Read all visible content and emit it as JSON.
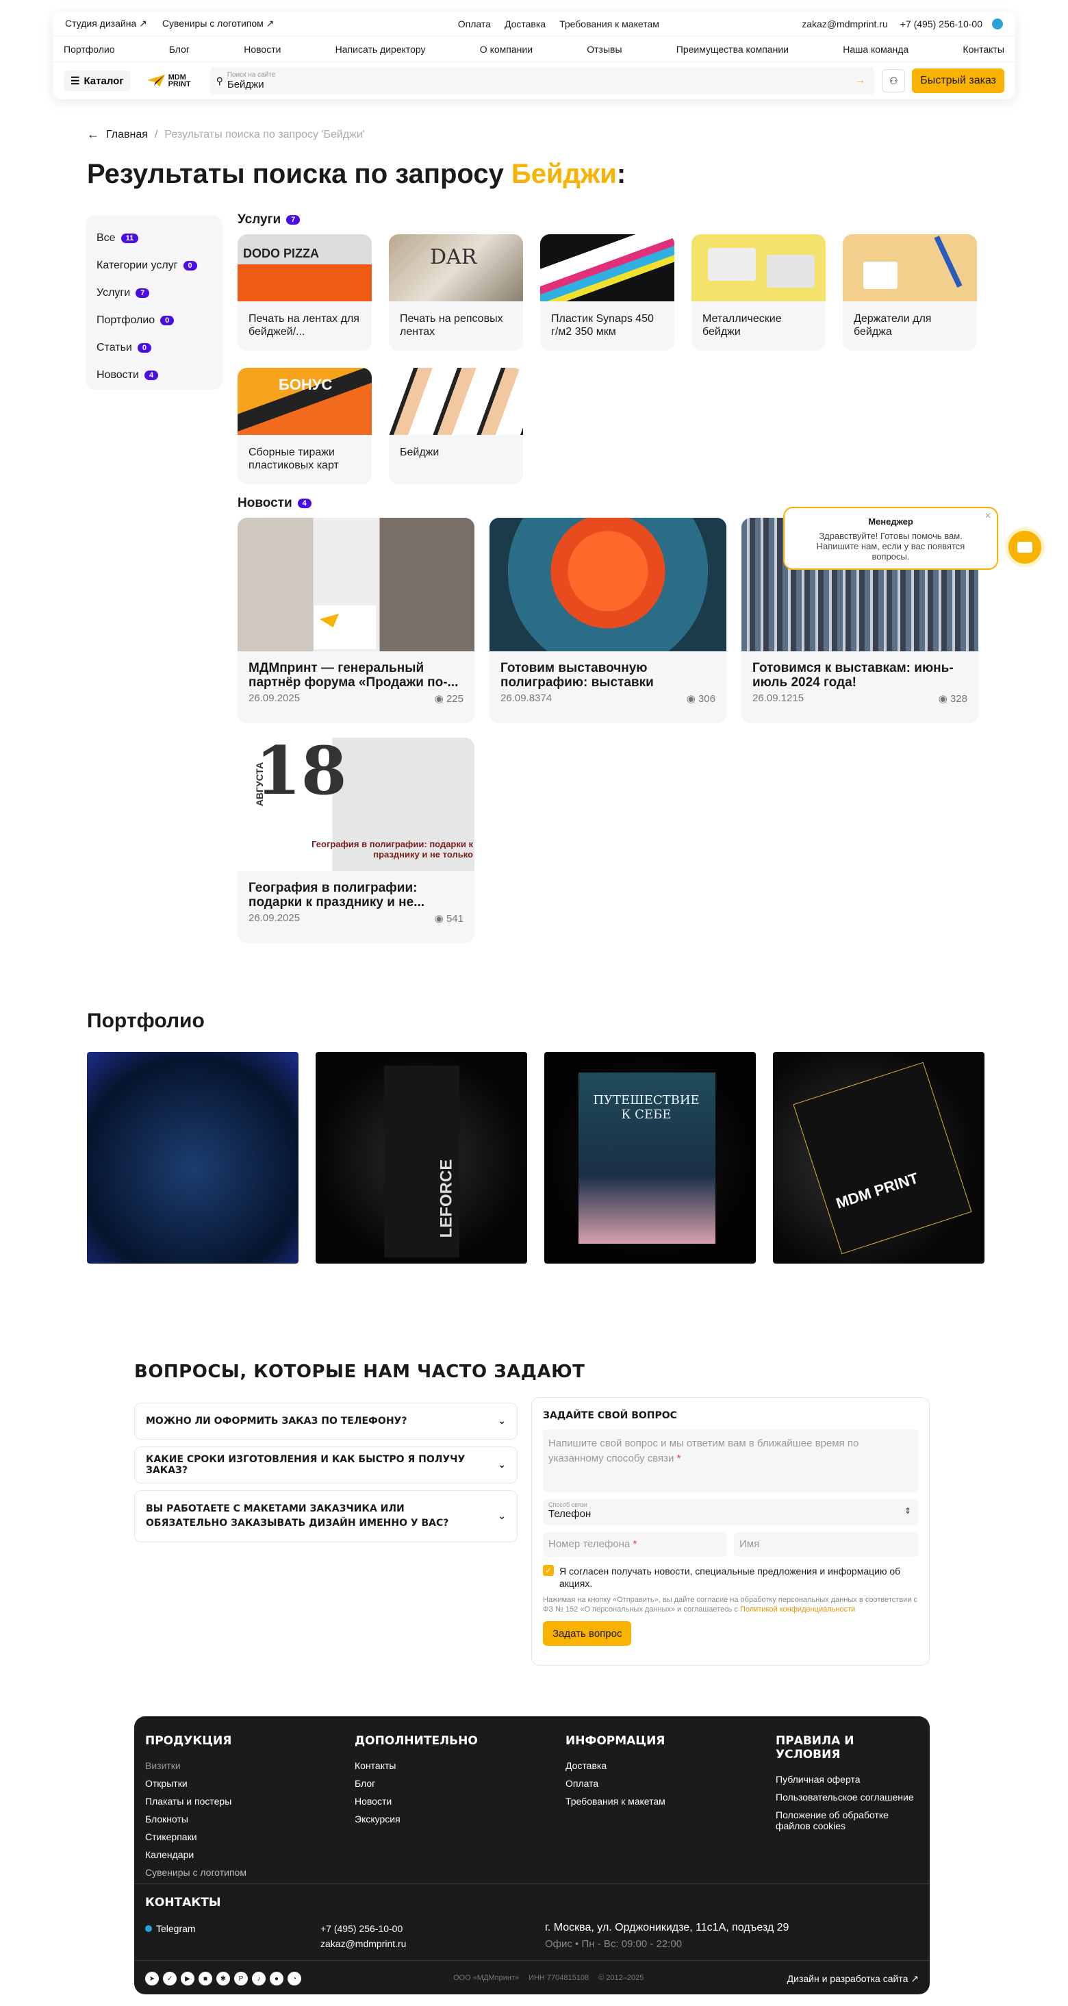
{
  "header": {
    "top_links": [
      "Студия дизайна ↗",
      "Сувениры с логотипом ↗"
    ],
    "top_center": [
      "Оплата",
      "Доставка",
      "Требования к макетам"
    ],
    "email": "zakaz@mdmprint.ru",
    "phone": "+7 (495) 256-10-00",
    "nav": [
      "Портфолио",
      "Блог",
      "Новости",
      "Написать директору",
      "О компании",
      "Отзывы",
      "Преимущества компании",
      "Наша команда",
      "Контакты"
    ],
    "catalog": "Каталог",
    "logo": "MDM PRINT",
    "search_placeholder": "Поиск на сайте",
    "search_value": "Бейджи",
    "quick_order": "Быстрый заказ"
  },
  "breadcrumb": {
    "home": "Главная",
    "sep": "/",
    "current": "Результаты поиска по запросу 'Бейджи'"
  },
  "title": {
    "prefix": "Результаты поиска по запросу ",
    "query": "Бейджи",
    "suffix": ":"
  },
  "sidebar": [
    {
      "label": "Все",
      "count": "11"
    },
    {
      "label": "Категории услуг",
      "count": "0"
    },
    {
      "label": "Услуги",
      "count": "7"
    },
    {
      "label": "Портфолио",
      "count": "0"
    },
    {
      "label": "Статьи",
      "count": "0"
    },
    {
      "label": "Новости",
      "count": "4"
    }
  ],
  "services": {
    "title": "Услуги",
    "count": "7",
    "items": [
      {
        "label": "Печать на лентах для бейджей/...",
        "img": "DODO PIZZA"
      },
      {
        "label": "Печать на репсовых лентах",
        "img": "DAR"
      },
      {
        "label": "Пластик Synaps 450 г/м2 350 мкм",
        "img": ""
      },
      {
        "label": "Металлические бейджи",
        "img": ""
      },
      {
        "label": "Держатели для бейджа",
        "img": ""
      },
      {
        "label": "Сборные тиражи пластиковых карт",
        "img": "БОНУС"
      },
      {
        "label": "Бейджи",
        "img": ""
      }
    ]
  },
  "news": {
    "title": "Новости",
    "count": "4",
    "items": [
      {
        "title": "МДМпринт — генеральный партнёр форума «Продажи по-...",
        "date": "26.09.2025",
        "views": "225"
      },
      {
        "title": "Готовим выставочную полиграфию: выставки августа...",
        "date": "26.09.8374",
        "views": "306"
      },
      {
        "title": "Готовимся к выставкам: июнь-июль 2024 года!",
        "date": "26.09.1215",
        "views": "328"
      },
      {
        "title": "География в полиграфии: подарки к празднику и не...",
        "date": "26.09.2025",
        "views": "541",
        "img_big": "18",
        "img_side": "АВГУСТА",
        "img_caption": "География в полиграфии: подарки к празднику и не только"
      }
    ]
  },
  "chat": {
    "title": "Менеджер",
    "text": "Здравствуйте! Готовы помочь вам. Напишите нам, если у вас появятся вопросы."
  },
  "portfolio": {
    "title": "Портфолио",
    "items": [
      {
        "caption": ""
      },
      {
        "caption": "LEFORCE"
      },
      {
        "caption": "ПУТЕШЕСТВИЕ К СЕБЕ"
      },
      {
        "caption": "MDM PRINT"
      }
    ]
  },
  "faq": {
    "title": "ВОПРОСЫ, КОТОРЫЕ НАМ ЧАСТО ЗАДАЮТ",
    "items": [
      "МОЖНО ЛИ ОФОРМИТЬ ЗАКАЗ ПО ТЕЛЕФОНУ?",
      "КАКИЕ СРОКИ ИЗГОТОВЛЕНИЯ И КАК БЫСТРО Я ПОЛУЧУ ЗАКАЗ?",
      "ВЫ РАБОТАЕТЕ С МАКЕТАМИ ЗАКАЗЧИКА ИЛИ ОБЯЗАТЕЛЬНО ЗАКАЗЫВАТЬ ДИЗАЙН ИМЕННО У ВАС?"
    ]
  },
  "form": {
    "title": "ЗАДАЙТЕ СВОЙ ВОПРОС",
    "question_placeholder": "Напишите свой вопрос и мы ответим вам в ближайшее время по указанному способу связи",
    "contact_label": "Способ связи",
    "contact_value": "Телефон",
    "phone_placeholder": "Номер телефона",
    "name_placeholder": "Имя",
    "consent": "Я согласен получать новости, специальные предложения и информацию об акциях.",
    "legal": "Нажимая на кнопку «Отправить», вы дайте согласие на обработку персональных данных в соответствии с ФЗ № 152 «О персональных данных» и соглашаетесь с",
    "legal_link": "Политикой конфиденциальности",
    "submit": "Задать вопрос"
  },
  "footer": {
    "cols": [
      {
        "title": "ПРОДУКЦИЯ",
        "items": [
          "Визитки",
          "Открытки",
          "Плакаты и постеры",
          "Блокноты",
          "Стикерпаки",
          "Календари",
          "Сувениры с логотипом"
        ]
      },
      {
        "title": "ДОПОЛНИТЕЛЬНО",
        "items": [
          "Контакты",
          "Блог",
          "Новости",
          "Экскурсия"
        ]
      },
      {
        "title": "ИНФОРМАЦИЯ",
        "items": [
          "Доставка",
          "Оплата",
          "Требования к макетам"
        ]
      },
      {
        "title": "ПРАВИЛА И УСЛОВИЯ",
        "items": [
          "Публичная оферта",
          "Пользовательское соглашение",
          "Положение об обработке файлов cookies"
        ]
      }
    ],
    "contacts_title": "КОНТАКТЫ",
    "telegram": "Telegram",
    "phone": "+7 (495) 256-10-00",
    "email": "zakaz@mdmprint.ru",
    "address": "г. Москва, ул. Орджоникидзе, 11с1А, подъезд 29",
    "hours": "Офис • Пн - Вс: 09:00 - 22:00",
    "company": "ООО «МДМпринт»",
    "inn": "ИНН 7704815108",
    "years": "© 2012–2025",
    "dev": "Дизайн и разработка сайта ↗"
  },
  "colors": {
    "accent": "#f9b200",
    "badge": "#4a0de3",
    "footer_bg": "#1b1b1b"
  }
}
